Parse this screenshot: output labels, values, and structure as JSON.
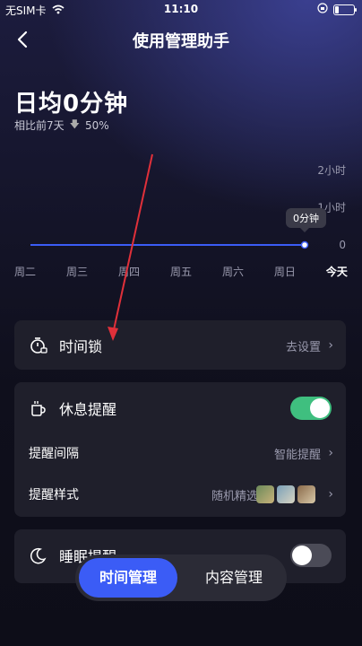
{
  "status_bar": {
    "carrier": "无SIM卡",
    "time": "11:10"
  },
  "nav": {
    "title": "使用管理助手"
  },
  "summary": {
    "daily_average": "日均0分钟",
    "compare_label": "相比前7天",
    "compare_change": "50%"
  },
  "chart_data": {
    "type": "line",
    "categories": [
      "周二",
      "周三",
      "周四",
      "周五",
      "周六",
      "周日",
      "今天"
    ],
    "y_tick_labels": [
      "2小时",
      "1小时",
      "0"
    ],
    "values": [
      0,
      0,
      0,
      0,
      0,
      0,
      0
    ],
    "ylim": [
      0,
      2
    ],
    "highlight_label": "0分钟",
    "line_color": "#3b5cf6"
  },
  "time_lock": {
    "label": "时间锁",
    "action": "去设置"
  },
  "rest_reminder": {
    "label": "休息提醒",
    "enabled": true,
    "interval_label": "提醒间隔",
    "interval_value": "智能提醒",
    "style_label": "提醒样式",
    "style_value": "随机精选"
  },
  "sleep_reminder": {
    "label": "睡眠提醒",
    "enabled": false
  },
  "tabs": [
    {
      "label": "时间管理",
      "active": true
    },
    {
      "label": "内容管理",
      "active": false
    }
  ],
  "colors": {
    "accent": "#3b5cf6",
    "toggle_on": "#3fbf7f",
    "annotation_arrow": "#e0303a"
  }
}
